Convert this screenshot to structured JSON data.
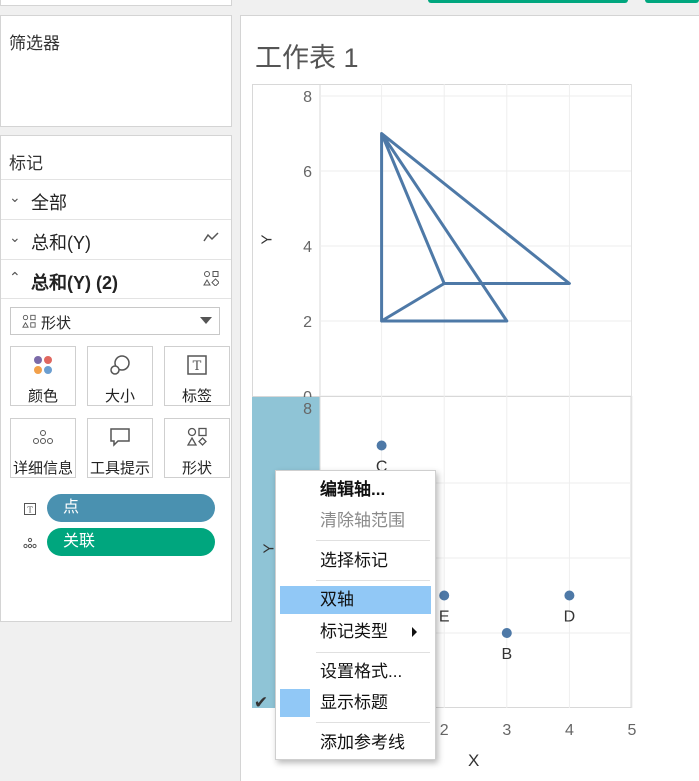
{
  "filters": {
    "title": "筛选器"
  },
  "marks": {
    "title": "标记",
    "rows": [
      {
        "label": "全部"
      },
      {
        "label": "总和(Y)"
      },
      {
        "label": "总和(Y) (2)"
      }
    ],
    "mark_type": "形状",
    "cards": [
      "颜色",
      "大小",
      "标签",
      "详细信息",
      "工具提示",
      "形状"
    ],
    "pills": [
      {
        "label": "点",
        "color": "#4a91b0"
      },
      {
        "label": "关联",
        "color": "#00a67e"
      }
    ]
  },
  "worksheet": {
    "title": "工作表 1",
    "y_axis_label": "Y",
    "x_axis_label": "X"
  },
  "context_menu": {
    "items": [
      "编辑轴...",
      "清除轴范围",
      "选择标记",
      "双轴",
      "标记类型",
      "设置格式...",
      "显示标题",
      "添加参考线"
    ]
  },
  "chart_data": [
    {
      "type": "line",
      "ylim": [
        0,
        8
      ],
      "y_ticks": [
        "8",
        "6",
        "4",
        "2",
        "0"
      ],
      "series": [
        {
          "points": [
            [
              1,
              7
            ],
            [
              3,
              2
            ],
            [
              1,
              2
            ],
            [
              1,
              7
            ],
            [
              4,
              3
            ],
            [
              2,
              3
            ],
            [
              1,
              2
            ],
            [
              2,
              3
            ],
            [
              1,
              7
            ]
          ]
        }
      ]
    },
    {
      "type": "scatter",
      "xlim": [
        0,
        5
      ],
      "ylim": [
        0,
        8
      ],
      "x_ticks": [
        "2",
        "3",
        "4",
        "5"
      ],
      "y_ticks": [
        "8"
      ],
      "points": [
        {
          "label": "C",
          "x": 1,
          "y": 7
        },
        {
          "label": "E",
          "x": 2,
          "y": 3
        },
        {
          "label": "D",
          "x": 4,
          "y": 3
        },
        {
          "label": "B",
          "x": 3,
          "y": 2
        }
      ]
    }
  ]
}
